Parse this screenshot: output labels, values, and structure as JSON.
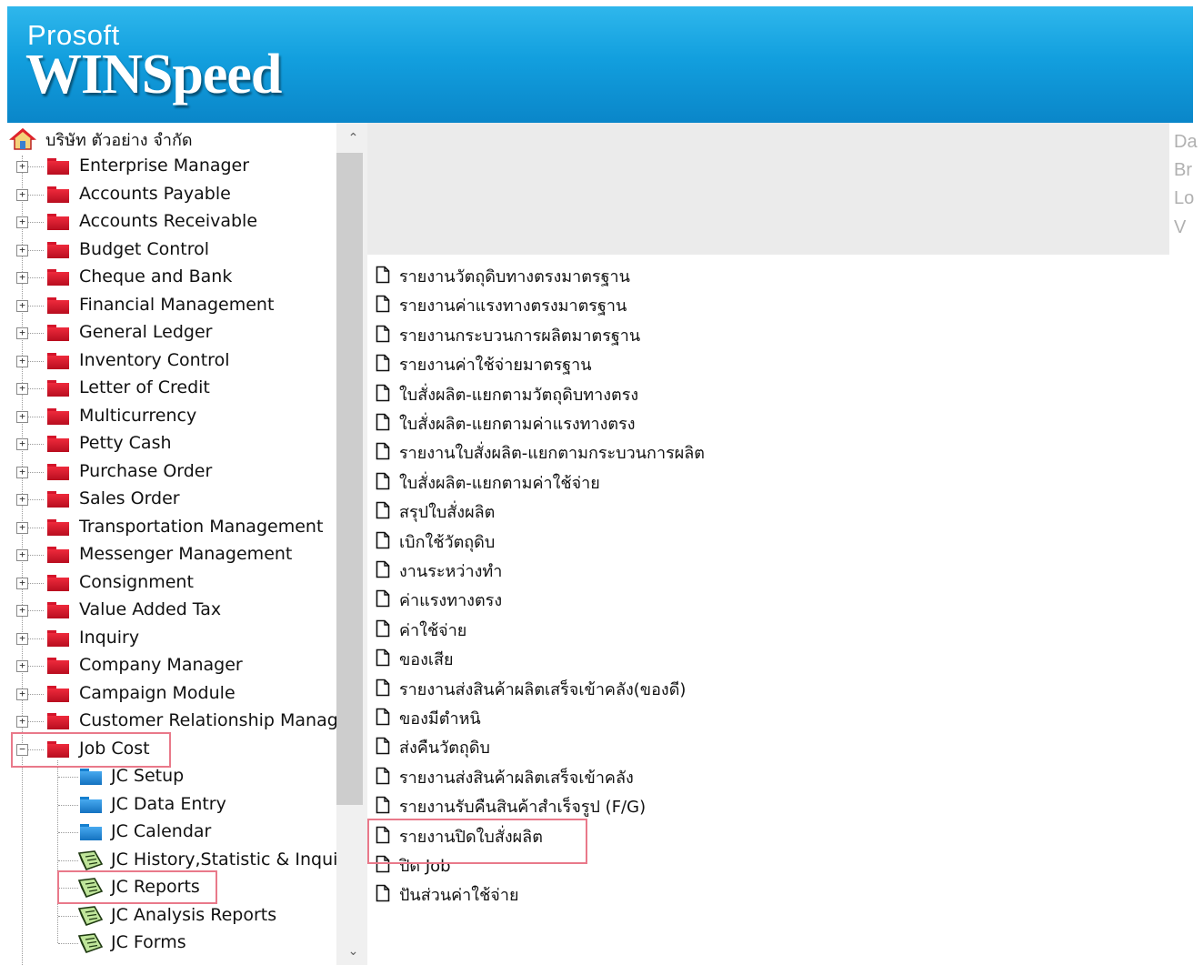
{
  "header": {
    "brand_top": "Prosoft",
    "brand_main": "WINSpeed"
  },
  "tree": {
    "root_label": "บริษัท ตัวอย่าง จำกัด",
    "modules": [
      "Enterprise Manager",
      "Accounts Payable",
      "Accounts Receivable",
      "Budget Control",
      "Cheque and Bank",
      "Financial Management",
      "General Ledger",
      "Inventory Control",
      "Letter of Credit",
      "Multicurrency",
      "Petty Cash",
      "Purchase Order",
      "Sales Order",
      "Transportation Management",
      "Messenger Management",
      "Consignment",
      "Value Added Tax",
      "Inquiry",
      "Company Manager",
      "Campaign Module",
      "Customer Relationship Manage"
    ],
    "expanded_module": "Job Cost",
    "children": [
      {
        "label": "JC Setup",
        "icon": "blue-folder-icon"
      },
      {
        "label": "JC Data Entry",
        "icon": "blue-folder-icon"
      },
      {
        "label": "JC Calendar",
        "icon": "blue-folder-icon"
      },
      {
        "label": "JC History,Statistic & Inquirie",
        "icon": "report-book-icon"
      },
      {
        "label": "JC Reports",
        "icon": "report-book-icon"
      },
      {
        "label": "JC Analysis Reports",
        "icon": "report-book-icon"
      },
      {
        "label": "JC Forms",
        "icon": "report-book-icon"
      }
    ]
  },
  "info_panel": {
    "labels": [
      "Da",
      "Br",
      "Lo",
      "V"
    ]
  },
  "reports": [
    "รายงานวัตถุดิบทางตรงมาตรฐาน",
    "รายงานค่าแรงทางตรงมาตรฐาน",
    "รายงานกระบวนการผลิตมาตรฐาน",
    "รายงานค่าใช้จ่ายมาตรฐาน",
    "ใบสั่งผลิต-แยกตามวัตถุดิบทางตรง",
    "ใบสั่งผลิต-แยกตามค่าแรงทางตรง",
    "รายงานใบสั่งผลิต-แยกตามกระบวนการผลิต",
    "ใบสั่งผลิต-แยกตามค่าใช้จ่าย",
    "สรุปใบสั่งผลิต",
    "เบิกใช้วัตถุดิบ",
    "งานระหว่างทำ",
    "ค่าแรงทางตรง",
    "ค่าใช้จ่าย",
    "ของเสีย",
    "รายงานส่งสินค้าผลิตเสร็จเข้าคลัง(ของดี)",
    "ของมีตำหนิ",
    "ส่งคืนวัตถุดิบ",
    "รายงานส่งสินค้าผลิตเสร็จเข้าคลัง",
    "รายงานรับคืนสินค้าสำเร็จรูป (F/G)",
    "รายงานปิดใบสั่งผลิต",
    "ปิด Job",
    "ปันส่วนค่าใช้จ่าย"
  ],
  "colors": {
    "header": "#129fde",
    "highlight": "#e9798a",
    "folder_red": "#d4142a",
    "folder_blue": "#157fcf"
  }
}
